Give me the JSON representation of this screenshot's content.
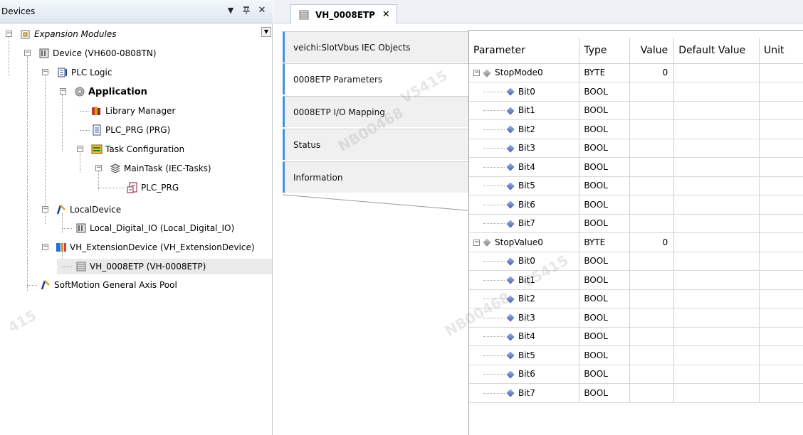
{
  "devices_panel": {
    "title": "Devices",
    "controls": {
      "dropdown": "▼",
      "pin": "ᵖ",
      "close": "✕"
    }
  },
  "tree": [
    {
      "label": "Expansion Modules",
      "italic": true
    },
    {
      "label": "Device (VH600-0808TN)"
    },
    {
      "label": "PLC Logic"
    },
    {
      "label": "Application",
      "bold": true
    },
    {
      "label": "Library Manager"
    },
    {
      "label": "PLC_PRG (PRG)"
    },
    {
      "label": "Task Configuration"
    },
    {
      "label": "MainTask (IEC-Tasks)"
    },
    {
      "label": "PLC_PRG"
    },
    {
      "label": "LocalDevice"
    },
    {
      "label": "Local_Digital_IO (Local_Digital_IO)"
    },
    {
      "label": "VH_ExtensionDevice (VH_ExtensionDevice)"
    },
    {
      "label": "VH_0008ETP (VH-0008ETP)"
    },
    {
      "label": "SoftMotion General Axis Pool"
    }
  ],
  "editor": {
    "tab_label": "VH_0008ETP",
    "side_tabs": [
      "veichi:SlotVbus IEC Objects",
      "0008ETP Parameters",
      "0008ETP I/O Mapping",
      "Status",
      "Information"
    ]
  },
  "table": {
    "headers": [
      "Parameter",
      "Type",
      "Value",
      "Default Value",
      "Unit"
    ],
    "rows": [
      {
        "name": "StopMode0",
        "type": "BYTE",
        "value": "0",
        "group": true
      },
      {
        "name": "Bit0",
        "type": "BOOL",
        "value": ""
      },
      {
        "name": "Bit1",
        "type": "BOOL",
        "value": ""
      },
      {
        "name": "Bit2",
        "type": "BOOL",
        "value": ""
      },
      {
        "name": "Bit3",
        "type": "BOOL",
        "value": ""
      },
      {
        "name": "Bit4",
        "type": "BOOL",
        "value": ""
      },
      {
        "name": "Bit5",
        "type": "BOOL",
        "value": ""
      },
      {
        "name": "Bit6",
        "type": "BOOL",
        "value": ""
      },
      {
        "name": "Bit7",
        "type": "BOOL",
        "value": ""
      },
      {
        "name": "StopValue0",
        "type": "BYTE",
        "value": "0",
        "group": true
      },
      {
        "name": "Bit0",
        "type": "BOOL",
        "value": ""
      },
      {
        "name": "Bit1",
        "type": "BOOL",
        "value": ""
      },
      {
        "name": "Bit2",
        "type": "BOOL",
        "value": ""
      },
      {
        "name": "Bit3",
        "type": "BOOL",
        "value": ""
      },
      {
        "name": "Bit4",
        "type": "BOOL",
        "value": ""
      },
      {
        "name": "Bit5",
        "type": "BOOL",
        "value": ""
      },
      {
        "name": "Bit6",
        "type": "BOOL",
        "value": ""
      },
      {
        "name": "Bit7",
        "type": "BOOL",
        "value": ""
      }
    ]
  },
  "colors": {
    "tab_accent": "#4a8fd8",
    "selected_row": "#eaeaea"
  }
}
